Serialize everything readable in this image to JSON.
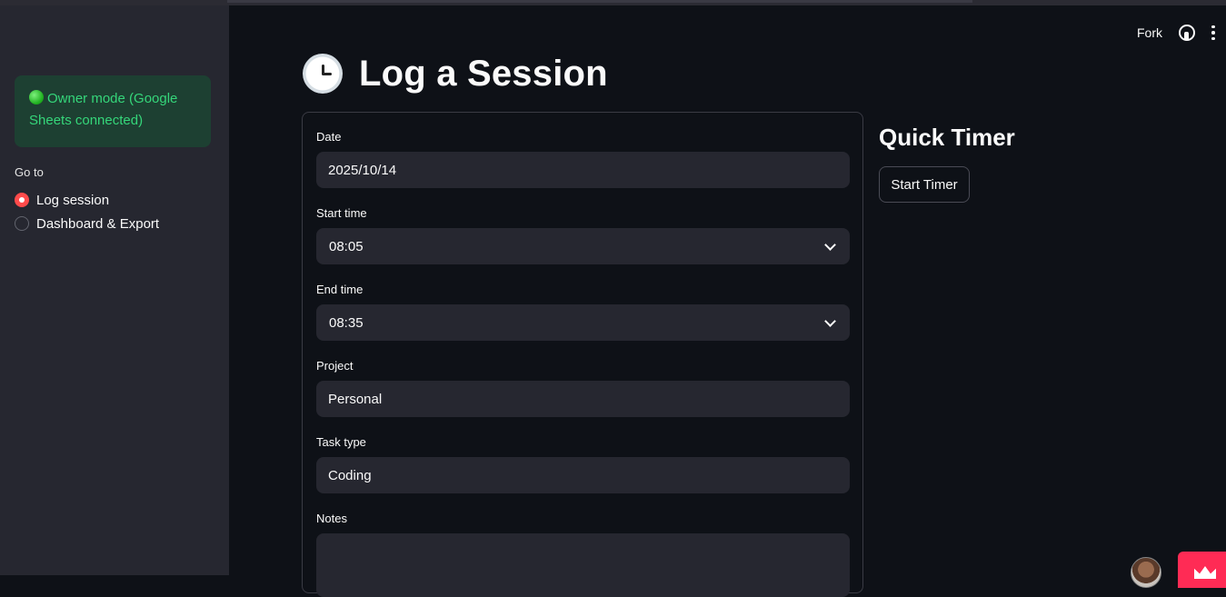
{
  "sidebar": {
    "owner_status": "Owner mode (Google Sheets connected)",
    "goto_label": "Go to",
    "nav_options": [
      {
        "label": "Log session",
        "selected": true
      },
      {
        "label": "Dashboard & Export",
        "selected": false
      }
    ]
  },
  "header": {
    "fork_label": "Fork",
    "github_icon": "github-icon",
    "menu_icon": "kebab-menu-icon"
  },
  "main": {
    "title": "Log a Session",
    "title_icon": "alarm-clock-icon",
    "form": {
      "date": {
        "label": "Date",
        "value": "2025/10/14"
      },
      "start_time": {
        "label": "Start time",
        "value": "08:05"
      },
      "end_time": {
        "label": "End time",
        "value": "08:35"
      },
      "project": {
        "label": "Project",
        "value": "Personal"
      },
      "task_type": {
        "label": "Task type",
        "value": "Coding"
      },
      "notes": {
        "label": "Notes",
        "value": ""
      }
    }
  },
  "quick_timer": {
    "title": "Quick Timer",
    "start_button": "Start Timer"
  },
  "colors": {
    "background": "#0e1117",
    "sidebar": "#262730",
    "accent": "#ff4b4b",
    "success_bg": "#1d4032",
    "success_text": "#35d67a",
    "input_bg": "#262730"
  }
}
